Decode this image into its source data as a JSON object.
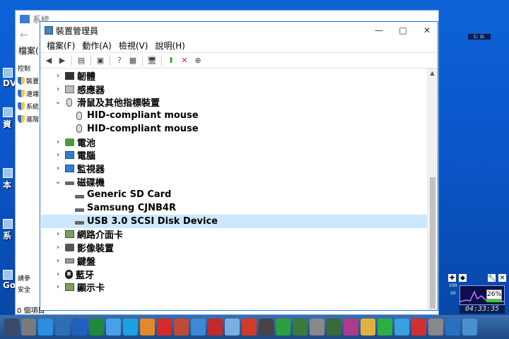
{
  "bg_window": {
    "title": "系統",
    "menu_label": "檔案(",
    "side_heading": "控制",
    "side_items": [
      "裝置",
      "遠端",
      "系統",
      "進階"
    ],
    "lower_items": [
      "請參",
      "安全"
    ],
    "status": "0 個項目"
  },
  "desktop_labels": [
    "DV",
    "資",
    "本",
    "系",
    "Go"
  ],
  "window": {
    "title": "裝置管理員",
    "minimize": "—",
    "maximize": "□",
    "close": "✕",
    "menus": [
      "檔案(F)",
      "動作(A)",
      "檢視(V)",
      "說明(H)"
    ]
  },
  "toolbar_icons": [
    "back-arrow-icon",
    "forward-arrow-icon",
    "properties-icon",
    "details-icon",
    "help-icon",
    "view-icon",
    "monitor-scan-icon",
    "update-driver-icon",
    "uninstall-icon",
    "download-icon"
  ],
  "tree": [
    {
      "label": "韌體",
      "expanded": false,
      "indent": 0,
      "icon": "firmware-icon"
    },
    {
      "label": "感應器",
      "expanded": false,
      "indent": 0,
      "icon": "sensor-icon"
    },
    {
      "label": "滑鼠及其他指標裝置",
      "expanded": true,
      "indent": 0,
      "icon": "mouse-icon"
    },
    {
      "label": "HID-compliant mouse",
      "indent": 1,
      "icon": "mouse-icon"
    },
    {
      "label": "HID-compliant mouse",
      "indent": 1,
      "icon": "mouse-icon"
    },
    {
      "label": "電池",
      "expanded": false,
      "indent": 0,
      "icon": "battery-icon"
    },
    {
      "label": "電腦",
      "expanded": false,
      "indent": 0,
      "icon": "computer-icon"
    },
    {
      "label": "監視器",
      "expanded": false,
      "indent": 0,
      "icon": "monitor-icon"
    },
    {
      "label": "磁碟機",
      "expanded": true,
      "indent": 0,
      "icon": "disk-icon"
    },
    {
      "label": "Generic  SD Card",
      "indent": 1,
      "icon": "disk-icon"
    },
    {
      "label": "Samsung CJNB4R",
      "indent": 1,
      "icon": "disk-icon"
    },
    {
      "label": "USB 3.0 SCSI Disk Device",
      "indent": 1,
      "icon": "disk-icon",
      "selected": true
    },
    {
      "label": "網路介面卡",
      "expanded": false,
      "indent": 0,
      "icon": "network-card-icon"
    },
    {
      "label": "影像裝置",
      "expanded": false,
      "indent": 0,
      "icon": "camera-icon"
    },
    {
      "label": "鍵盤",
      "expanded": false,
      "indent": 0,
      "icon": "keyboard-icon"
    },
    {
      "label": "藍牙",
      "expanded": false,
      "indent": 0,
      "icon": "bluetooth-icon"
    },
    {
      "label": "顯示卡",
      "expanded": false,
      "indent": 0,
      "icon": "display-adapter-icon"
    }
  ],
  "gadget": {
    "percent": "26%",
    "time": "04:33:35",
    "scale_top": "100",
    "scale_mid": "50"
  },
  "top_gadget": [
    "C:",
    "D:"
  ],
  "taskbar_icons": [
    "calculator-icon",
    "finder-icon",
    "ie-icon",
    "monitor-icon",
    "word-icon",
    "excel-icon",
    "clock-icon",
    "qq-icon",
    "firefox-icon",
    "opera-icon",
    "firewall-icon",
    "bird-icon",
    "teeth-icon",
    "book-icon",
    "ladybug-icon",
    "speaker-icon",
    "music-icon",
    "news-icon",
    "clock-icon",
    "chart-icon",
    "disk-icon",
    "face-icon",
    "line-icon",
    "play-icon",
    "flag-icon",
    "cat-icon",
    "globe-icon",
    "mail-icon"
  ],
  "colors": {
    "desktop": "#0a55c8",
    "selection": "#cce8ff",
    "title_accent": "#2b79d8"
  }
}
